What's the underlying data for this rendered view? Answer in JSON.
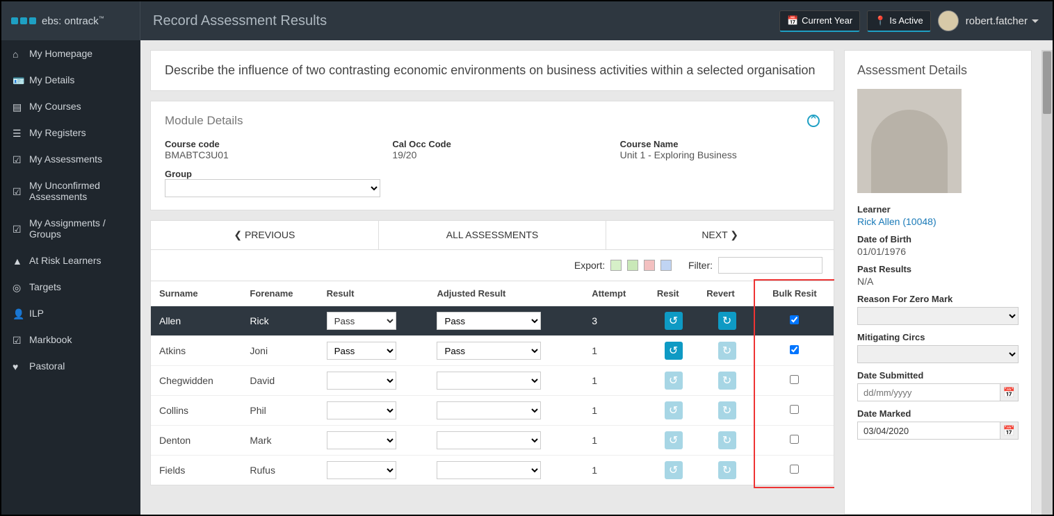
{
  "app": {
    "brand": "ebs: ontrack",
    "tm": "™"
  },
  "header": {
    "title": "Record Assessment Results",
    "current_year": "Current Year",
    "is_active": "Is Active",
    "username": "robert.fatcher"
  },
  "sidebar": {
    "items": [
      {
        "label": "My Homepage"
      },
      {
        "label": "My Details"
      },
      {
        "label": "My Courses"
      },
      {
        "label": "My Registers"
      },
      {
        "label": "My Assessments"
      },
      {
        "label": "My Unconfirmed Assessments"
      },
      {
        "label": "My Assignments / Groups"
      },
      {
        "label": "At Risk Learners"
      },
      {
        "label": "Targets"
      },
      {
        "label": "ILP"
      },
      {
        "label": "Markbook"
      },
      {
        "label": "Pastoral"
      }
    ]
  },
  "description": "Describe the influence of two contrasting economic environments on business activities within a selected organisation",
  "module": {
    "panel_title": "Module Details",
    "labels": {
      "course_code": "Course code",
      "cal_occ": "Cal Occ Code",
      "course_name": "Course Name",
      "group": "Group"
    },
    "course_code": "BMABTC3U01",
    "cal_occ_code": "19/20",
    "course_name": "Unit 1 - Exploring Business"
  },
  "nav": {
    "prev": "PREVIOUS",
    "all": "ALL ASSESSMENTS",
    "next": "NEXT"
  },
  "export": {
    "label": "Export:",
    "filter": "Filter:"
  },
  "table": {
    "columns": {
      "surname": "Surname",
      "forename": "Forename",
      "result": "Result",
      "adjusted": "Adjusted Result",
      "attempt": "Attempt",
      "resit": "Resit",
      "revert": "Revert",
      "bulk": "Bulk Resit"
    },
    "rows": [
      {
        "surname": "Allen",
        "forename": "Rick",
        "result": "Pass",
        "adjusted": "Pass",
        "attempt": "3",
        "resit_active": true,
        "revert_active": true,
        "bulk": true,
        "selected": true
      },
      {
        "surname": "Atkins",
        "forename": "Joni",
        "result": "Pass",
        "adjusted": "Pass",
        "attempt": "1",
        "resit_active": true,
        "revert_active": false,
        "bulk": true,
        "selected": false
      },
      {
        "surname": "Chegwidden",
        "forename": "David",
        "result": "",
        "adjusted": "",
        "attempt": "1",
        "resit_active": false,
        "revert_active": false,
        "bulk": false,
        "selected": false
      },
      {
        "surname": "Collins",
        "forename": "Phil",
        "result": "",
        "adjusted": "",
        "attempt": "1",
        "resit_active": false,
        "revert_active": false,
        "bulk": false,
        "selected": false
      },
      {
        "surname": "Denton",
        "forename": "Mark",
        "result": "",
        "adjusted": "",
        "attempt": "1",
        "resit_active": false,
        "revert_active": false,
        "bulk": false,
        "selected": false
      },
      {
        "surname": "Fields",
        "forename": "Rufus",
        "result": "",
        "adjusted": "",
        "attempt": "1",
        "resit_active": false,
        "revert_active": false,
        "bulk": false,
        "selected": false
      }
    ]
  },
  "details": {
    "title": "Assessment Details",
    "labels": {
      "learner": "Learner",
      "dob": "Date of Birth",
      "past": "Past Results",
      "reason": "Reason For Zero Mark",
      "mitigating": "Mitigating Circs",
      "submitted": "Date Submitted",
      "marked": "Date Marked"
    },
    "learner_link": "Rick Allen (10048)",
    "dob": "01/01/1976",
    "past_results": "N/A",
    "date_submitted_placeholder": "dd/mm/yyyy",
    "date_marked": "03/04/2020"
  }
}
